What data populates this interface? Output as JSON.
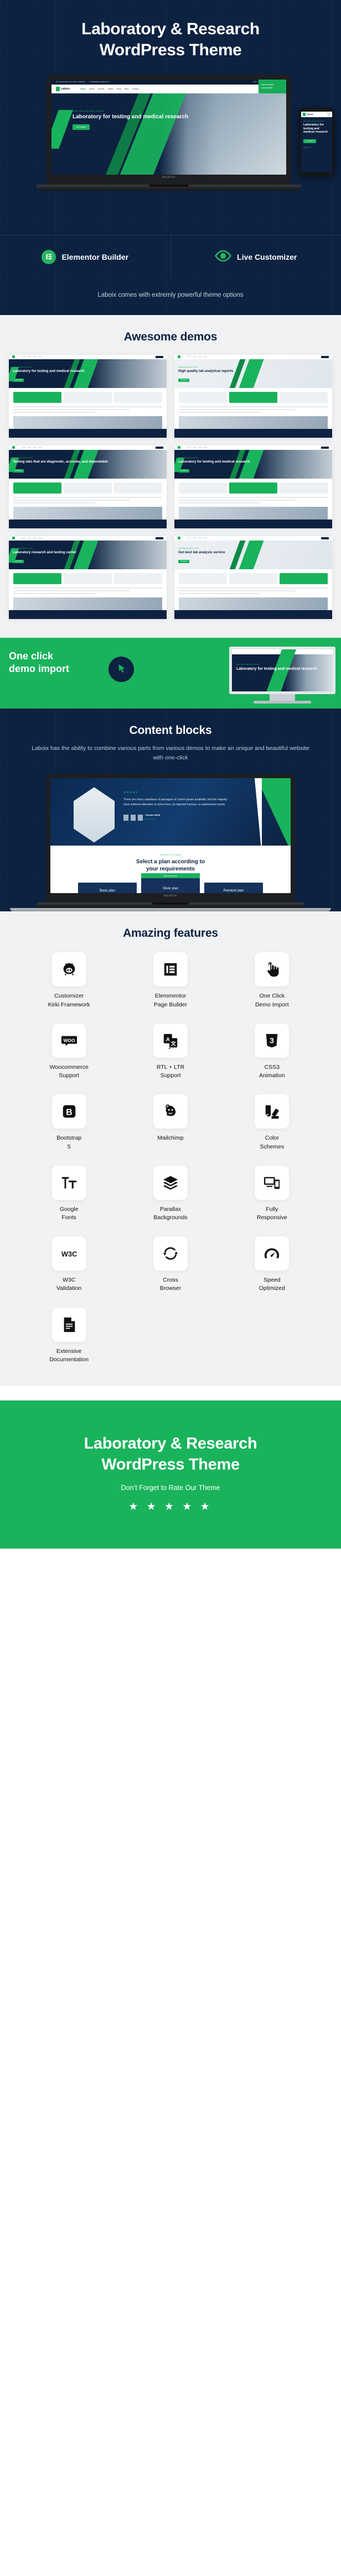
{
  "hero": {
    "title_line1": "Laboratory & Research",
    "title_line2": "WordPress Theme",
    "tagline": "Laboix comes with extremly powerful theme options",
    "badges": [
      {
        "label": "Elementor Builder",
        "icon": "elementor-icon"
      },
      {
        "label": "Live Customizer",
        "icon": "eye-icon"
      }
    ],
    "mock": {
      "topbar_left": "82 Commercial road Torton, Australia",
      "topbar_mail": "needhelp@company.com",
      "topbar_right": "Sun : Mon 8.00 to 6.00 Thu : Closed",
      "logo": "Laboix",
      "menu": [
        "Home",
        "About",
        "Service",
        "Pages",
        "Shop",
        "Blog",
        "Contact"
      ],
      "nav_button": "Appointment",
      "green_box_title": "Call Us Anytime",
      "green_box_phone": "+91 8400 3045",
      "kicker": "High quality laboratory services",
      "heading": "Laboratory for testing and medical research",
      "cta": "Get Started",
      "laptop_brand": "MacBook"
    },
    "phone": {
      "logo": "Laboix",
      "kicker": "High quality laboratory services",
      "heading": "Laboratory for testing and medical research",
      "cta": "Get Started"
    }
  },
  "demos": {
    "title": "Awesome demos",
    "items": [
      {
        "kicker": "High quality laboratory services",
        "heading": "Laboratory for testing and medical research",
        "cta": "Get Started",
        "style": "navy"
      },
      {
        "kicker": "High quality laboratory services",
        "heading": "High quality lab analytical reports",
        "cta": "Get Started",
        "style": "light"
      },
      {
        "kicker": "High quality laboratory services",
        "heading": "Testing labs that are diagnostic, accurate, and dependable",
        "cta": "Get Started",
        "style": "navy"
      },
      {
        "kicker": "High quality laboratory services",
        "heading": "Laboratory for testing and medical research",
        "cta": "Get Started",
        "style": "navy"
      },
      {
        "kicker": "High quality laboratory services",
        "heading": "Laboratory research and testing center",
        "cta": "Get Started",
        "style": "navy"
      },
      {
        "kicker": "High quality laboratory services",
        "heading": "Get best lab analysis service",
        "cta": "Get Started",
        "style": "light"
      }
    ]
  },
  "oneclick": {
    "title_line1": "One click",
    "title_line2": "demo import",
    "icon": "cursor-click-icon",
    "monitor": {
      "kicker": "High quality laboratory services",
      "heading": "Laboratory for testing and medical research"
    }
  },
  "blocks": {
    "title": "Content blocks",
    "subtitle": "Laboix has the ability to combine various parts from various demos to make an unique and beautiful website with one-click",
    "screen": {
      "stars": "★★★★★",
      "quote": "There are many variations of passages of Lorem Ipsum available, but the majority have suffered alteration in some form, by injected humour, or randomised words",
      "author_name": "Thomas Webb",
      "author_role": "Senior doctor",
      "pricing_kicker": "PRICING PLANS",
      "pricing_title_line1": "Select a plan according to",
      "pricing_title_line2": "your requirements",
      "recommended_label": "Recommended",
      "plans": [
        "Basic plan",
        "Silver plan",
        "Premium plan"
      ]
    },
    "laptop_brand": "MacBook"
  },
  "features": {
    "title": "Amazing features",
    "items": [
      {
        "icon": "kirki-pig-icon",
        "label_line1": "Customizer",
        "label_line2": "Kirki Framework"
      },
      {
        "icon": "elementor-icon",
        "label_line1": "Elemmentor",
        "label_line2": "Page Builder"
      },
      {
        "icon": "click-hand-icon",
        "label_line1": "One Click",
        "label_line2": "Demo Import"
      },
      {
        "icon": "woocommerce-icon",
        "label_line1": "Woocommerce",
        "label_line2": "Support"
      },
      {
        "icon": "translate-icon",
        "label_line1": "RTL + LTR",
        "label_line2": "Support"
      },
      {
        "icon": "css3-icon",
        "label_line1": "CSS3",
        "label_line2": "Animation"
      },
      {
        "icon": "bootstrap-icon",
        "label_line1": "Bootstrap",
        "label_line2": "5"
      },
      {
        "icon": "mailchimp-icon",
        "label_line1": "Mailchimp",
        "label_line2": ""
      },
      {
        "icon": "color-swatch-icon",
        "label_line1": "Color",
        "label_line2": "Schemes"
      },
      {
        "icon": "google-fonts-icon",
        "label_line1": "Google",
        "label_line2": "Fonts"
      },
      {
        "icon": "layers-icon",
        "label_line1": "Parallax",
        "label_line2": "Backgrounds"
      },
      {
        "icon": "devices-icon",
        "label_line1": "Fully",
        "label_line2": "Responsive"
      },
      {
        "icon": "w3c-icon",
        "label_line1": "W3C",
        "label_line2": "Validation"
      },
      {
        "icon": "cross-browser-icon",
        "label_line1": "Cross",
        "label_line2": "Browser"
      },
      {
        "icon": "speedometer-icon",
        "label_line1": "Speed",
        "label_line2": "Optimized"
      },
      {
        "icon": "document-icon",
        "label_line1": "Extensive",
        "label_line2": "Documentation"
      }
    ]
  },
  "footer": {
    "title_line1": "Laboratory & Research",
    "title_line2": "WordPress Theme",
    "subtitle": "Don’t Forget to Rate Our Theme",
    "stars": "★ ★ ★ ★ ★"
  },
  "colors": {
    "navy": "#0d2141",
    "green": "#19b35c",
    "light": "#f1f2f3"
  }
}
